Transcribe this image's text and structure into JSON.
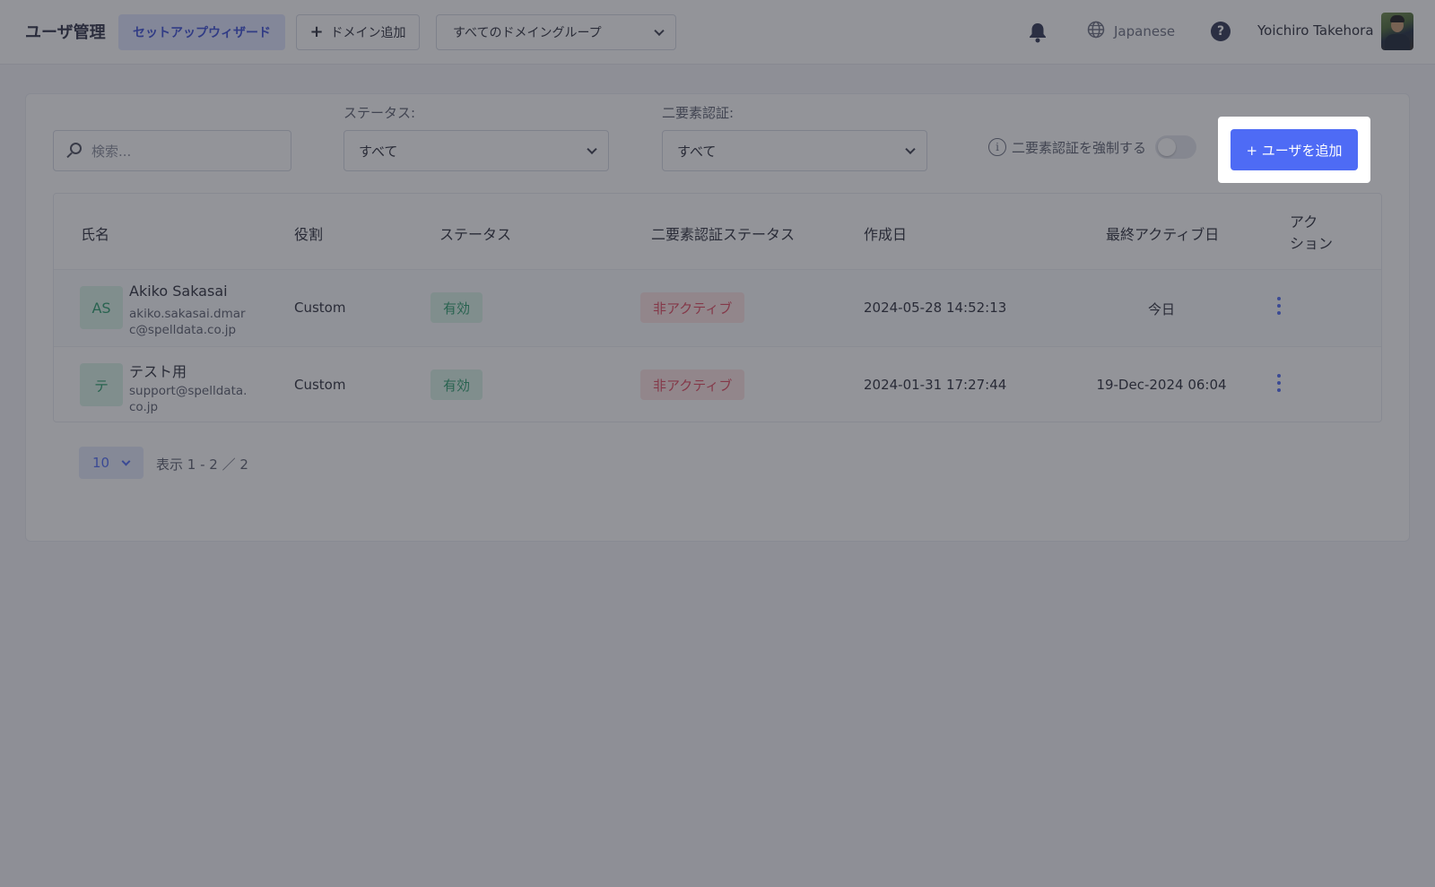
{
  "header": {
    "title": "ユーザ管理",
    "setup_wizard_label": "セットアップウィザード",
    "add_domain_label": "ドメイン追加",
    "domain_group_selected": "すべてのドメイングループ",
    "language": "Japanese",
    "help_glyph": "?",
    "user_name": "Yoichiro Takehora",
    "icons": [
      "bell-icon",
      "globe-icon",
      "help-icon",
      "avatar"
    ]
  },
  "filters": {
    "search_placeholder": "検索...",
    "status_label": "ステータス:",
    "status_selected": "すべて",
    "twofa_label": "二要素認証:",
    "twofa_selected": "すべて",
    "enforce_twofa_label": "二要素認証を強制する",
    "enforce_twofa_on": false,
    "info_glyph": "i",
    "add_user_label": "+ ユーザを追加"
  },
  "table": {
    "columns": [
      "氏名",
      "役割",
      "ステータス",
      "二要素認証ステータス",
      "作成日",
      "最終アクティブ日",
      "アク\nション"
    ],
    "rows": [
      {
        "initials": "AS",
        "name": "Akiko Sakasai",
        "email": "akiko.sakasai.dmarc@spelldata.co.jp",
        "role": "Custom",
        "status": "有効",
        "twofa_status": "非アクティブ",
        "created": "2024-05-28 14:52:13",
        "last_active": "今日"
      },
      {
        "initials": "テ",
        "name": "テスト用",
        "email": "support@spelldata.co.jp",
        "role": "Custom",
        "status": "有効",
        "twofa_status": "非アクティブ",
        "created": "2024-01-31 17:27:44",
        "last_active": "19-Dec-2024 06:04"
      }
    ]
  },
  "pagination": {
    "page_size": "10",
    "range_text": "表示 1 - 2 ／ 2"
  },
  "colors": {
    "primary": "#4e6bf5",
    "active_badge_bg": "#d9f2e7",
    "active_badge_text": "#2a9d6c",
    "inactive_badge_bg": "#fde3e3",
    "inactive_badge_text": "#e0485e",
    "overlay": "rgba(40,42,52,0.5)"
  }
}
